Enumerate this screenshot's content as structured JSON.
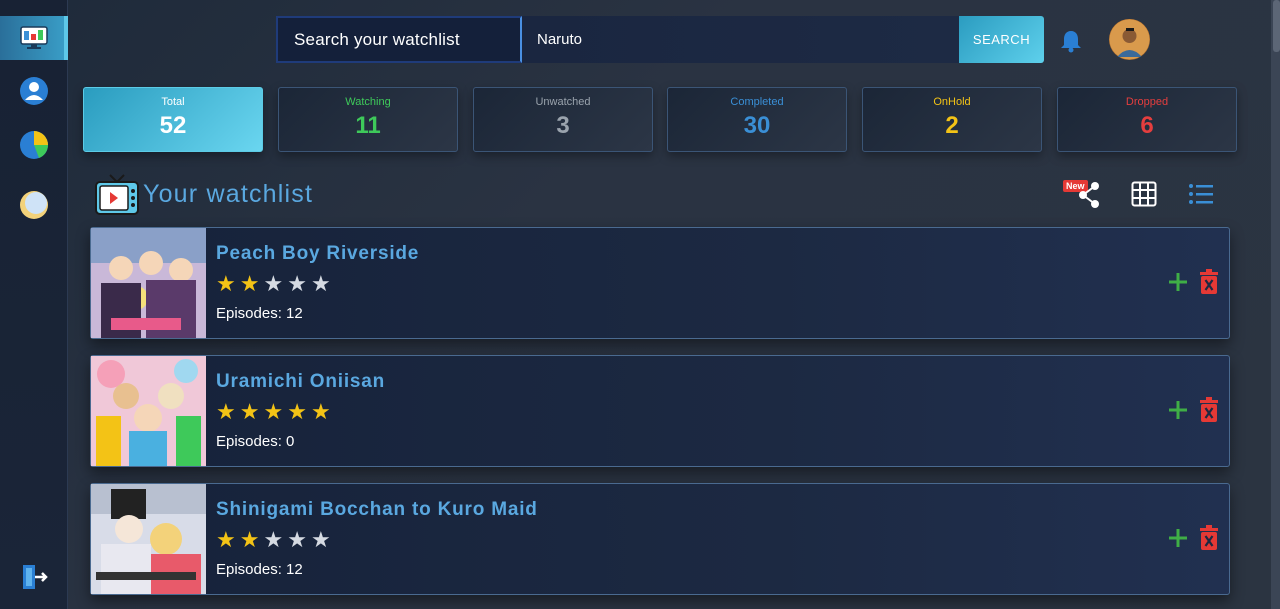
{
  "sidebar": {
    "items": [
      {
        "name": "dashboard",
        "icon": "monitor-chart-icon",
        "active": true
      },
      {
        "name": "profile",
        "icon": "user-icon",
        "active": false
      },
      {
        "name": "stats",
        "icon": "pie-chart-icon",
        "active": false
      },
      {
        "name": "theme",
        "icon": "moon-icon",
        "active": false
      }
    ],
    "logout_icon": "logout-icon"
  },
  "search": {
    "label": "Search your watchlist",
    "value": "Naruto",
    "button": "SEARCH"
  },
  "header": {
    "bell_icon": "bell-icon",
    "avatar_icon": "avatar"
  },
  "stats": [
    {
      "label": "Total",
      "value": "52",
      "color": "#ffffff"
    },
    {
      "label": "Watching",
      "value": "11",
      "color": "#3ec95a"
    },
    {
      "label": "Unwatched",
      "value": "3",
      "color": "#9aa3ad"
    },
    {
      "label": "Completed",
      "value": "30",
      "color": "#3a8fd6"
    },
    {
      "label": "OnHold",
      "value": "2",
      "color": "#f3c316"
    },
    {
      "label": "Dropped",
      "value": "6",
      "color": "#e53e3e"
    }
  ],
  "watchlist": {
    "title": "Your watchlist",
    "new_badge": "New",
    "items": [
      {
        "title": "Peach Boy Riverside",
        "rating": 2,
        "episodes": "Episodes: 12"
      },
      {
        "title": "Uramichi Oniisan",
        "rating": 5,
        "episodes": "Episodes: 0"
      },
      {
        "title": "Shinigami Bocchan to Kuro Maid",
        "rating": 2,
        "episodes": "Episodes: 12"
      }
    ]
  },
  "colors": {
    "accent": "#5aa8e0",
    "star_on": "#f3c316",
    "star_off": "#d5dae2",
    "add": "#3fae46",
    "delete": "#e53935"
  }
}
